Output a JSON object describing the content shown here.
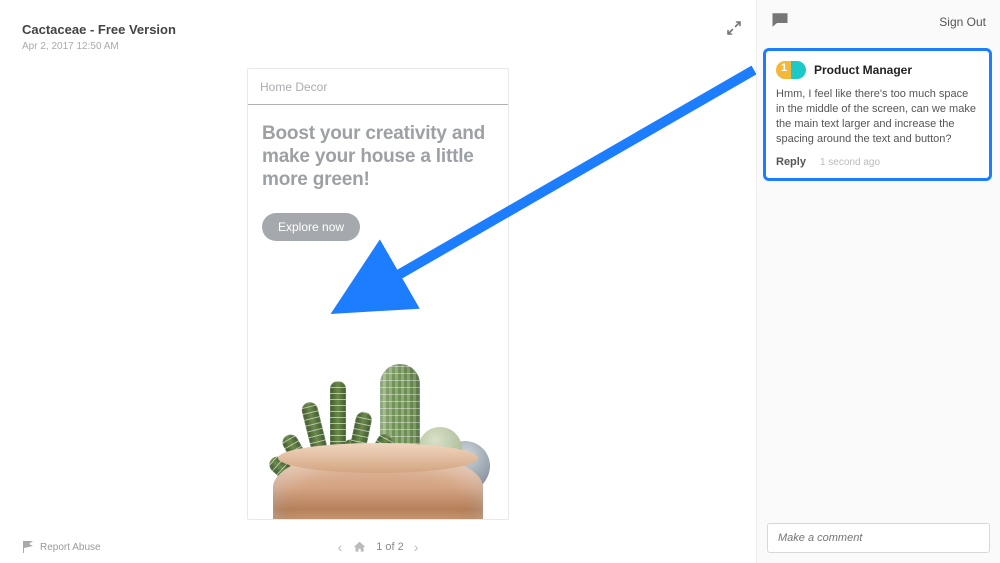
{
  "header": {
    "title": "Cactaceae - Free Version",
    "timestamp": "Apr 2, 2017 12:50 AM"
  },
  "mockup": {
    "nav_title": "Home Decor",
    "headline": "Boost your creativity and make your house a little more green!",
    "cta_label": "Explore now"
  },
  "marker": {
    "number": "1"
  },
  "pager": {
    "label": "1 of 2"
  },
  "report_abuse": "Report Abuse",
  "side": {
    "sign_out": "Sign Out",
    "comment": {
      "badge": "1",
      "author": "Product Manager",
      "text": "Hmm, I feel like there's too much space in the middle of the screen, can we make the main text larger and increase the spacing around the text and button?",
      "reply": "Reply",
      "ago": "1 second ago"
    },
    "input_placeholder": "Make a comment"
  }
}
